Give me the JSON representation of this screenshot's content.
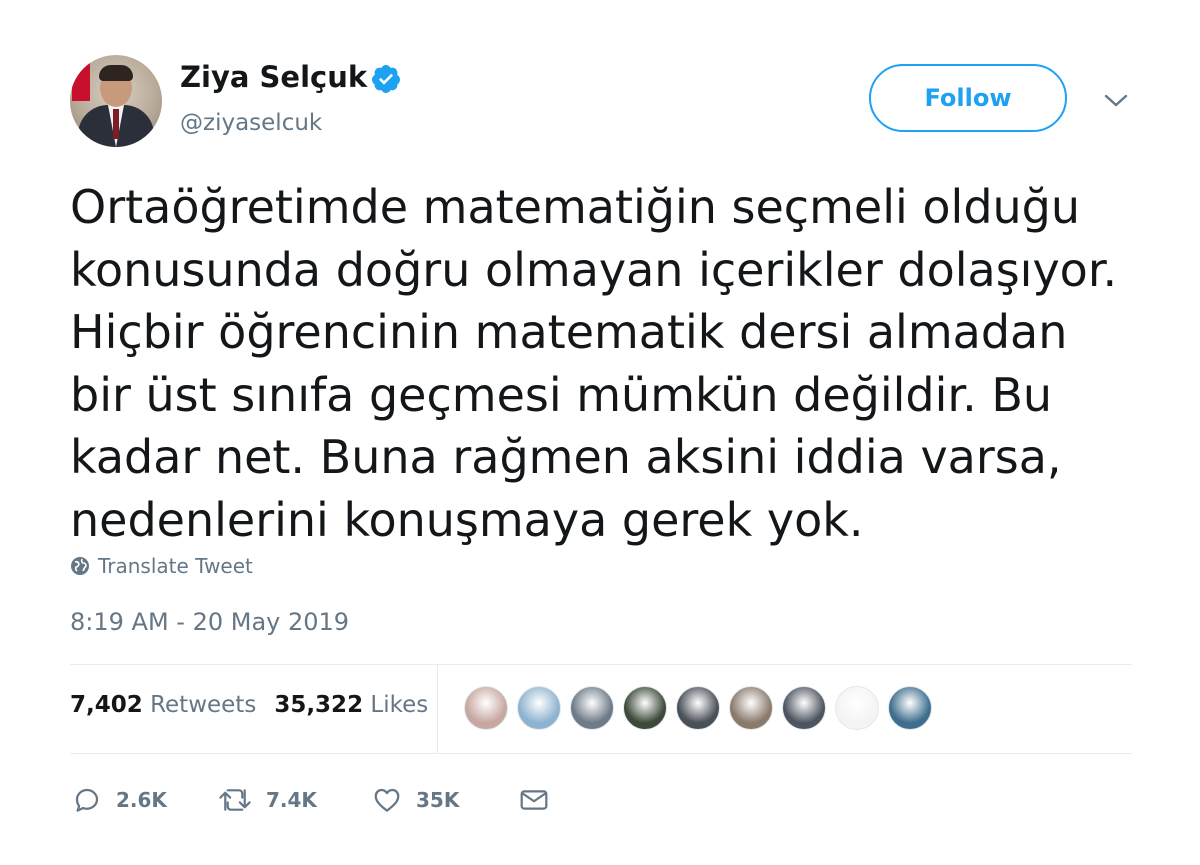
{
  "user": {
    "name": "Ziya Selçuk",
    "handle": "@ziyaselcuk",
    "verified": true
  },
  "follow_button": {
    "label": "Follow"
  },
  "tweet": {
    "text": "Ortaöğretimde matematiğin seçmeli olduğu\nkonusunda doğru olmayan içerikler dolaşıyor.\nHiçbir öğrencinin matematik dersi almadan\nbir üst sınıfa geçmesi mümkün değildir. Bu\nkadar net. Buna rağmen aksini iddia varsa,\nnedenlerini konuşmaya gerek yok.",
    "translate_label": "Translate Tweet",
    "timestamp": "8:19 AM - 20 May 2019"
  },
  "stats": {
    "retweets_count": "7,402",
    "retweets_label": "Retweets",
    "likes_count": "35,322",
    "likes_label": "Likes"
  },
  "likers": [
    {
      "name": "liker-avatar-1",
      "color": "#c7a7a0"
    },
    {
      "name": "liker-avatar-2",
      "color": "#8fb3cf"
    },
    {
      "name": "liker-avatar-3",
      "color": "#6e7a86"
    },
    {
      "name": "liker-avatar-4",
      "color": "#3d4a3a"
    },
    {
      "name": "liker-avatar-5",
      "color": "#4a5058"
    },
    {
      "name": "liker-avatar-6",
      "color": "#8a7a6c"
    },
    {
      "name": "liker-avatar-7",
      "color": "#4f5560"
    },
    {
      "name": "liker-avatar-8",
      "color": "#f4f4f4"
    },
    {
      "name": "liker-avatar-9",
      "color": "#3e6e8e"
    }
  ],
  "actions": {
    "reply_count": "2.6K",
    "retweet_count": "7.4K",
    "like_count": "35K"
  },
  "colors": {
    "accent": "#1da1f2",
    "text_primary": "#14171a",
    "text_secondary": "#657786",
    "divider": "#e6ecf0"
  }
}
